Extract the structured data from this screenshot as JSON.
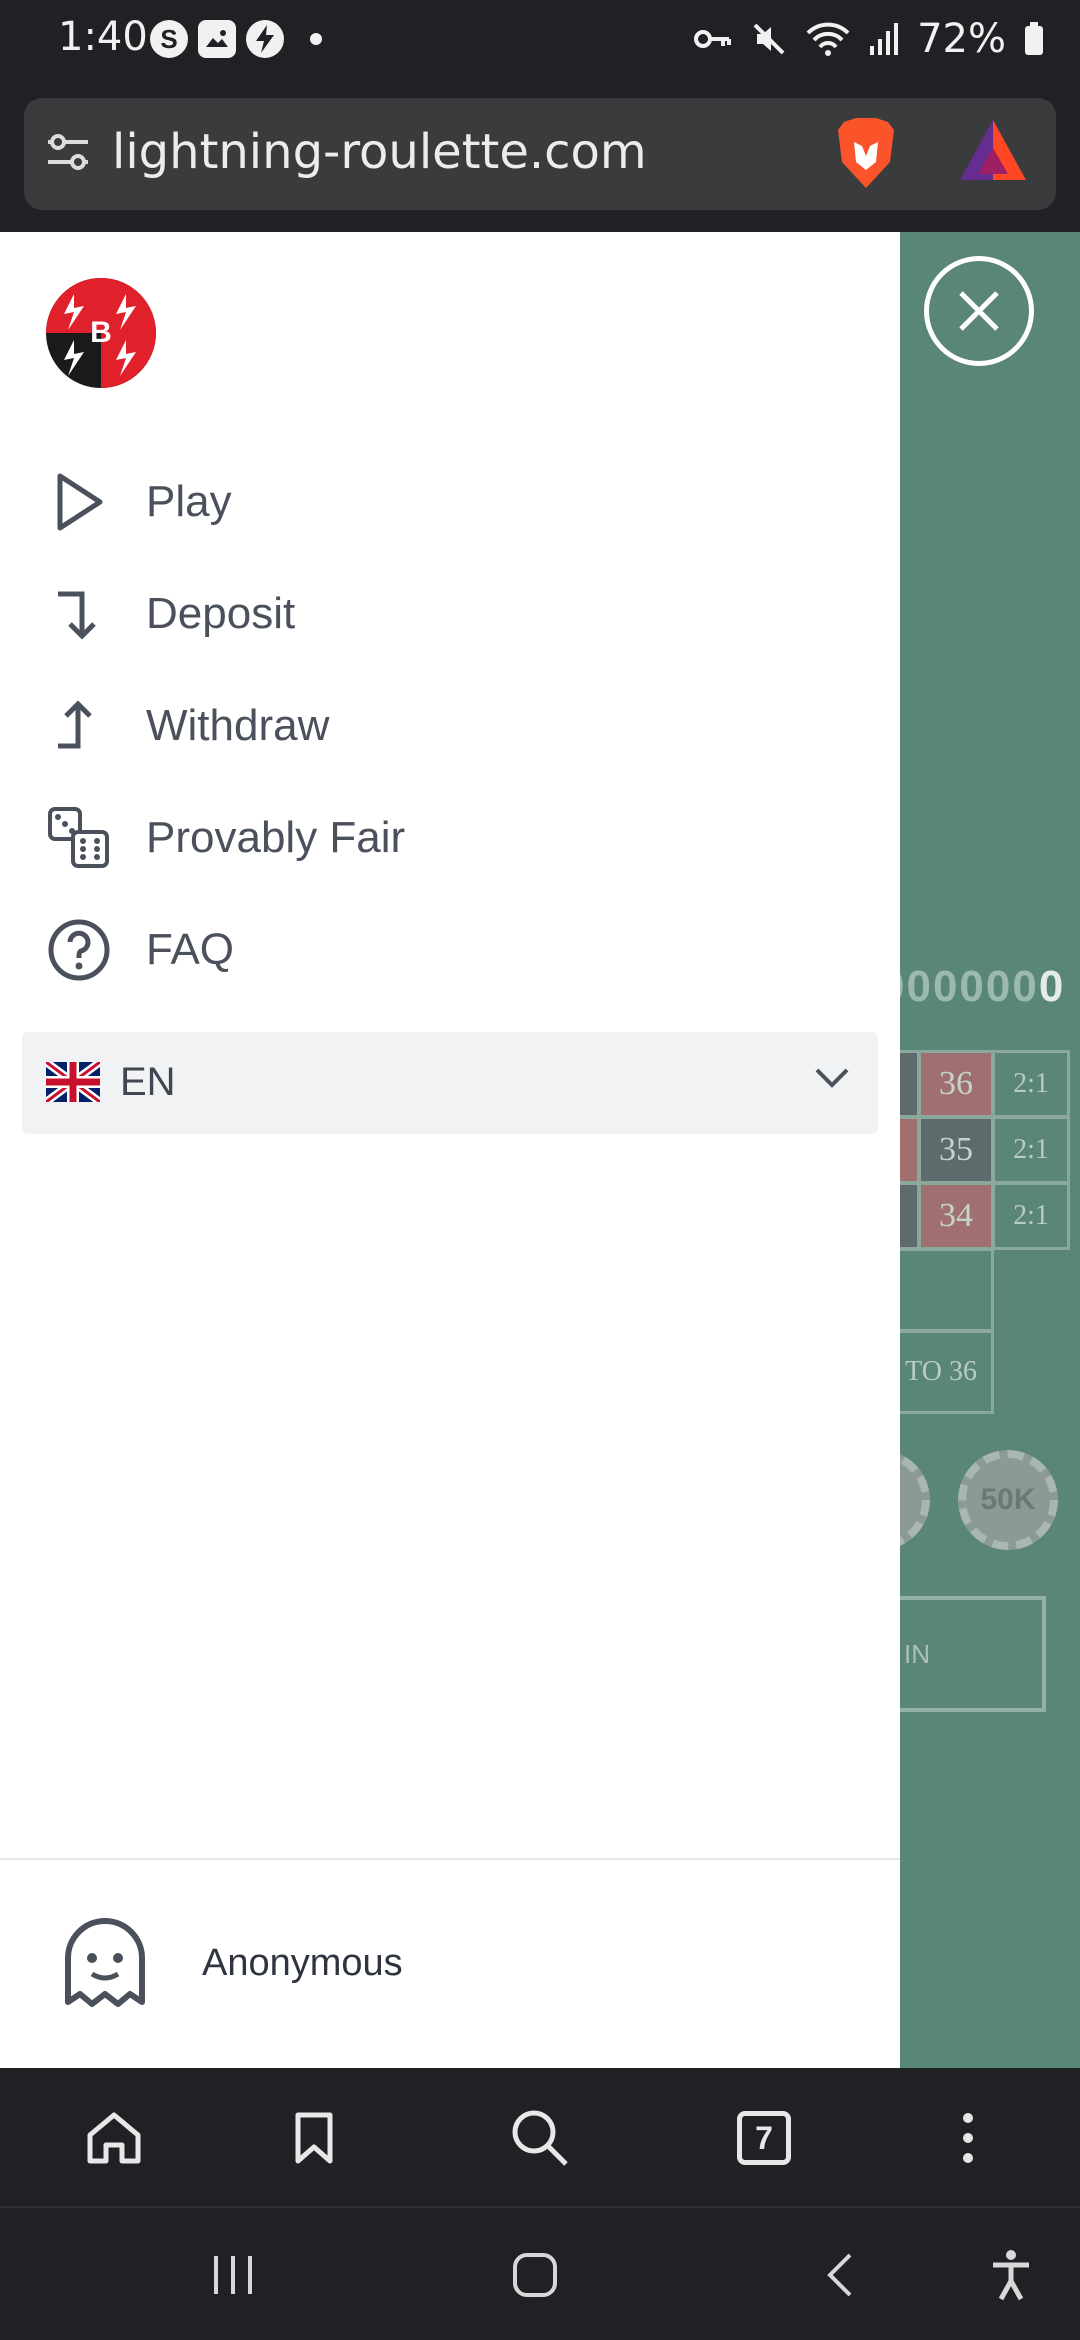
{
  "status_bar": {
    "time": "1:40",
    "battery_percent": "72%",
    "left_icons": [
      "s-circle-icon",
      "gallery-icon",
      "bolt-icon",
      "dot"
    ],
    "right_icons": [
      "vpn-key-icon",
      "mute-icon",
      "wifi-icon",
      "signal-icon",
      "battery-icon"
    ]
  },
  "browser": {
    "url": "lightning-roulette.com",
    "tab_count": "7",
    "toolbar_icons": [
      "home-icon",
      "bookmark-icon",
      "search-icon",
      "tabs-icon",
      "more-icon"
    ]
  },
  "drawer": {
    "menu": [
      {
        "label": "Play",
        "icon": "play-icon"
      },
      {
        "label": "Deposit",
        "icon": "deposit-arrow-icon"
      },
      {
        "label": "Withdraw",
        "icon": "withdraw-arrow-icon"
      },
      {
        "label": "Provably Fair",
        "icon": "dice-icon"
      },
      {
        "label": "FAQ",
        "icon": "question-icon"
      }
    ],
    "language": {
      "selected": "EN",
      "flag": "uk-flag-icon"
    },
    "user": {
      "name": "Anonymous",
      "icon": "ghost-icon"
    }
  },
  "game_background": {
    "balance": "000000",
    "balance_last": "0",
    "numbers": [
      "36",
      "35",
      "34"
    ],
    "column_bets": [
      "2:1",
      "2:1",
      "2:1"
    ],
    "range_label": "TO 36",
    "chip": "50K",
    "spin_label": "IN"
  },
  "colors": {
    "drawer_bg": "#ffffff",
    "game_bg": "#5a8677",
    "text": "#4a505c",
    "chrome_bg": "#202124"
  }
}
